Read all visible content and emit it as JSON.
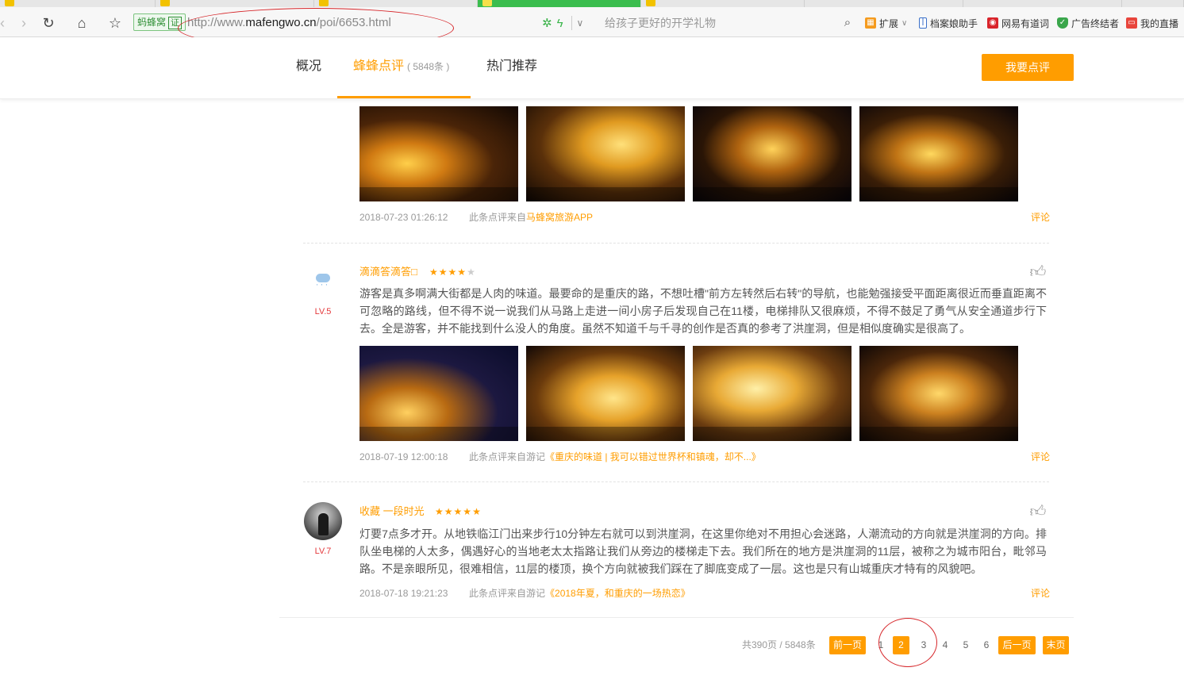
{
  "browser": {
    "url_prefix": "http://www.",
    "url_domain": "mafengwo.cn",
    "url_path": "/poi/6653.html",
    "cert_label": "蚂蜂窝",
    "cert_mark": "证",
    "search_placeholder": "给孩子更好的开学礼物",
    "extensions": [
      {
        "label": "扩展",
        "icon": "extensions-icon"
      },
      {
        "label": "档案娘助手",
        "icon": "archive-assistant-icon"
      },
      {
        "label": "网易有道词",
        "icon": "youdao-icon"
      },
      {
        "label": "广告终结者",
        "icon": "adblock-shield-icon"
      },
      {
        "label": "我的直播",
        "icon": "live-tv-icon"
      }
    ]
  },
  "page_nav": {
    "tabs": [
      {
        "label": "概况"
      },
      {
        "label": "蜂蜂点评",
        "count": "( 5848条 )"
      },
      {
        "label": "热门推荐"
      }
    ],
    "review_button": "我要点评"
  },
  "reviews": [
    {
      "date": "2018-07-23 01:26:12",
      "source_prefix": "此条点评来自",
      "source_link": "马蜂窝旅游APP",
      "comment_label": "评论"
    },
    {
      "username": "滴滴答滴答□",
      "level": "LV.5",
      "stars": 4,
      "text": "游客是真多啊满大街都是人肉的味道。最要命的是重庆的路，不想吐槽\"前方左转然后右转\"的导航，也能勉强接受平面距离很近而垂直距离不可忽略的路线，但不得不说一说我们从马路上走进一间小房子后发现自己在11楼，电梯排队又很麻烦，不得不鼓足了勇气从安全通道步行下去。全是游客，并不能找到什么没人的角度。虽然不知道千与千寻的创作是否真的参考了洪崖洞，但是相似度确实是很高了。",
      "date": "2018-07-19 12:00:18",
      "source_prefix": "此条点评来自游记",
      "source_link": "《重庆的味道 | 我可以错过世界杯和镇魂，却不...》",
      "comment_label": "评论"
    },
    {
      "username": "收藏 一段时光",
      "level": "LV.7",
      "stars": 5,
      "text": "灯要7点多才开。从地铁临江门出来步行10分钟左右就可以到洪崖洞，在这里你绝对不用担心会迷路，人潮流动的方向就是洪崖洞的方向。排队坐电梯的人太多，偶遇好心的当地老太太指路让我们从旁边的楼梯走下去。我们所在的地方是洪崖洞的11层，被称之为城市阳台，毗邻马路。不是亲眼所见，很难相信，11层的楼顶，换个方向就被我们踩在了脚底变成了一层。这也是只有山城重庆才特有的风貌吧。",
      "date": "2018-07-18 19:21:23",
      "source_prefix": "此条点评来自游记",
      "source_link": "《2018年夏，和重庆的一场热恋》",
      "comment_label": "评论"
    }
  ],
  "pagination": {
    "summary": "共390页 / 5848条",
    "prev": "前一页",
    "pages": [
      "1",
      "2",
      "3",
      "4",
      "5",
      "6"
    ],
    "current": "2",
    "next": "后一页",
    "last": "末页"
  },
  "colors": {
    "accent": "#ff9d00",
    "level_red": "#e4393c",
    "annotation_red": "#d6262a"
  }
}
